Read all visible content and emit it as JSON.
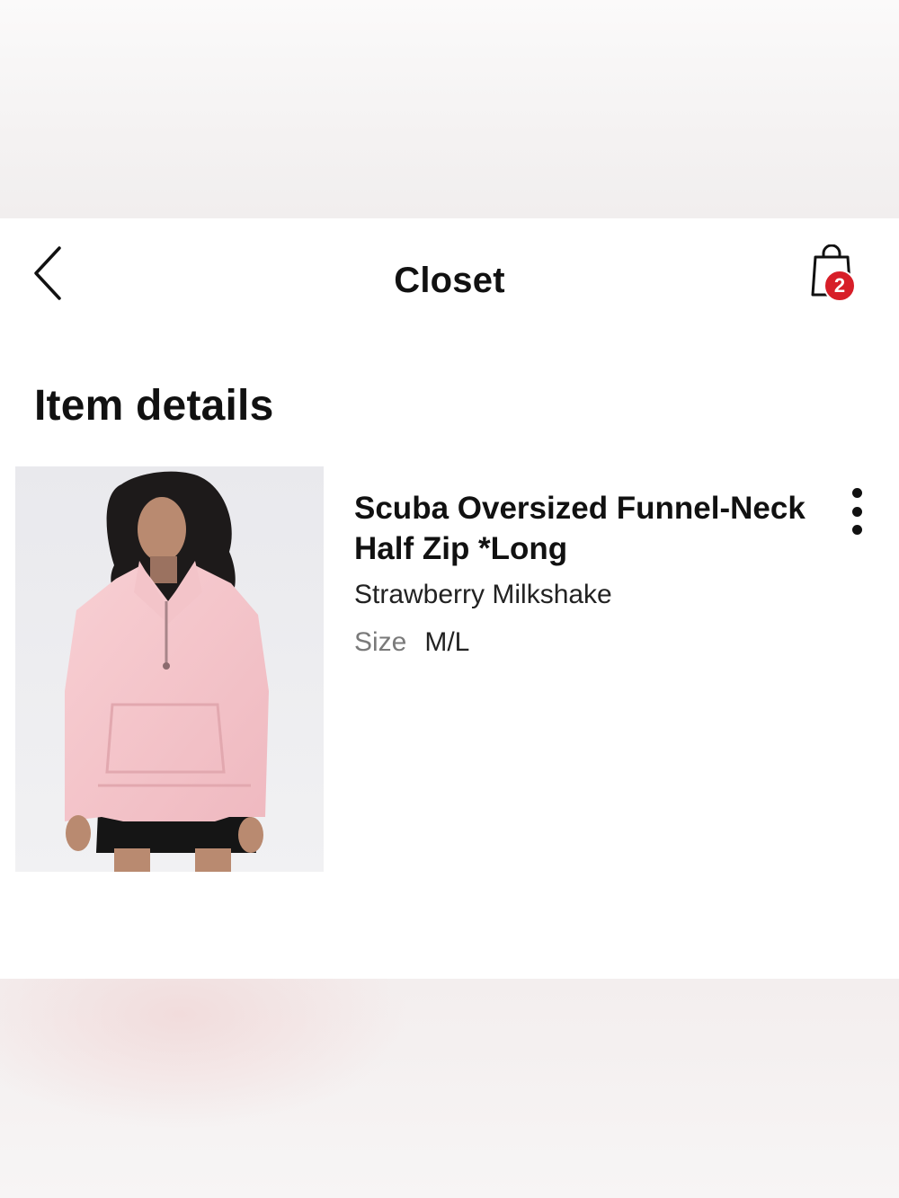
{
  "header": {
    "title": "Closet",
    "bag_count": "2"
  },
  "page": {
    "heading": "Item details"
  },
  "product": {
    "name": "Scuba Oversized Funnel-Neck Half Zip *Long",
    "color": "Strawberry Milkshake",
    "size_label": "Size",
    "size_value": "M/L"
  },
  "icons": {
    "back": "chevron-left-icon",
    "bag": "shopping-bag-icon",
    "more": "more-vertical-icon"
  },
  "colors": {
    "badge": "#d71e28",
    "text": "#111111",
    "muted": "#7a7a7a"
  }
}
